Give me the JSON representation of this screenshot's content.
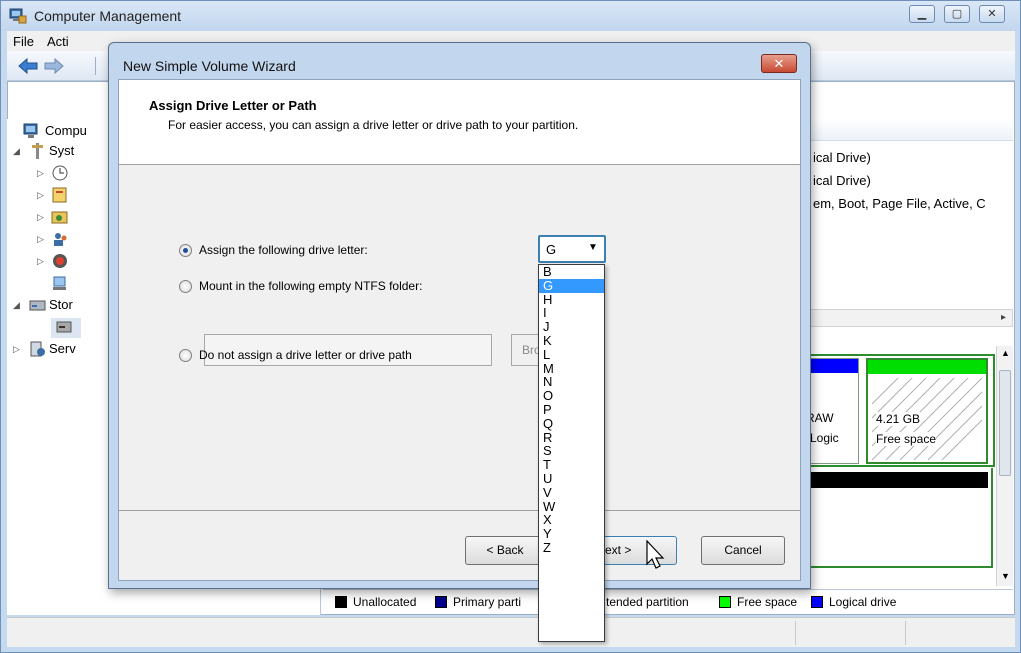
{
  "main_window": {
    "title": "Computer Management",
    "menu": [
      "File",
      "Acti"
    ],
    "tree": [
      {
        "label": "Compu",
        "indent": 0
      },
      {
        "label": "Syst",
        "indent": 1
      },
      {
        "label": "Stor",
        "indent": 1
      },
      {
        "label": "Serv",
        "indent": 1
      }
    ],
    "list_rows": [
      "ical Drive)",
      "ical Drive)",
      "em, Boot, Page File, Active, C"
    ],
    "partitions": {
      "raw": {
        "line1": "RAW",
        "line2": "(Logic"
      },
      "free": {
        "line1": "4.21 GB",
        "line2": "Free space"
      }
    },
    "legend": [
      {
        "label": "Unallocated",
        "color": "#000000"
      },
      {
        "label": "Primary parti",
        "color": "#00008b"
      },
      {
        "label": "tended partition",
        "color": "#00ff00"
      },
      {
        "label": "Free space",
        "color": "#00ff00"
      },
      {
        "label": "Logical drive",
        "color": "#0000ff"
      }
    ],
    "window_buttons": {
      "minimize": "▁",
      "maximize": "▢",
      "close": "✕"
    }
  },
  "wizard": {
    "title": "New Simple Volume Wizard",
    "close_label": "✕",
    "heading": "Assign Drive Letter or Path",
    "subheading": "For easier access, you can assign a drive letter or drive path to your partition.",
    "options": {
      "assign_letter": "Assign the following drive letter:",
      "mount_folder": "Mount in the following empty NTFS folder:",
      "no_assign": "Do not assign a drive letter or drive path"
    },
    "browse_label": "Bro",
    "buttons": {
      "back": "< Back",
      "next": "Next >",
      "next_visible": "ext >",
      "cancel": "Cancel"
    },
    "drive_letter": {
      "selected": "G",
      "options": [
        "B",
        "G",
        "H",
        "I",
        "J",
        "K",
        "L",
        "M",
        "N",
        "O",
        "P",
        "Q",
        "R",
        "S",
        "T",
        "U",
        "V",
        "W",
        "X",
        "Y",
        "Z"
      ]
    }
  }
}
